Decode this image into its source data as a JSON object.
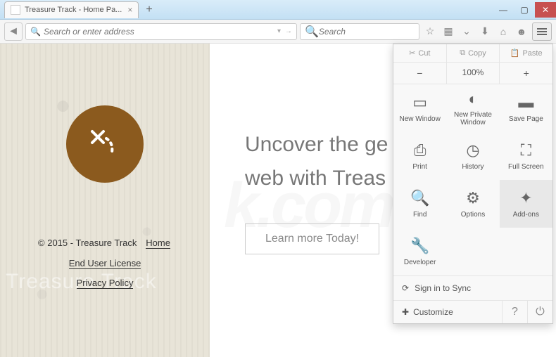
{
  "window": {
    "tab_title": "Treasure Track - Home Pa..."
  },
  "nav": {
    "address_placeholder": "Search or enter address",
    "search_placeholder": "Search"
  },
  "page": {
    "headline1": "Uncover the ge",
    "headline2": "web with Treas",
    "cta": "Learn more Today!",
    "copyright": "© 2015 - Treasure Track",
    "links": {
      "home": "Home",
      "eula": "End User License",
      "privacy": "Privacy Policy"
    },
    "brand_wm": "Treasure Track",
    "main_wm": "k.com"
  },
  "menu": {
    "edit": {
      "cut": "Cut",
      "copy": "Copy",
      "paste": "Paste"
    },
    "zoom": {
      "minus": "−",
      "level": "100%",
      "plus": "+"
    },
    "items": [
      {
        "label": "New Window",
        "icon": "▭"
      },
      {
        "label": "New Private Window",
        "icon": "◐"
      },
      {
        "label": "Save Page",
        "icon": "▬"
      },
      {
        "label": "Print",
        "icon": "⎙"
      },
      {
        "label": "History",
        "icon": "◷"
      },
      {
        "label": "Full Screen",
        "icon": "⛶"
      },
      {
        "label": "Find",
        "icon": "🔍"
      },
      {
        "label": "Options",
        "icon": "⚙"
      },
      {
        "label": "Add-ons",
        "icon": "✦"
      },
      {
        "label": "Developer",
        "icon": "🔧"
      }
    ],
    "sync": "Sign in to Sync",
    "customize": "Customize"
  }
}
